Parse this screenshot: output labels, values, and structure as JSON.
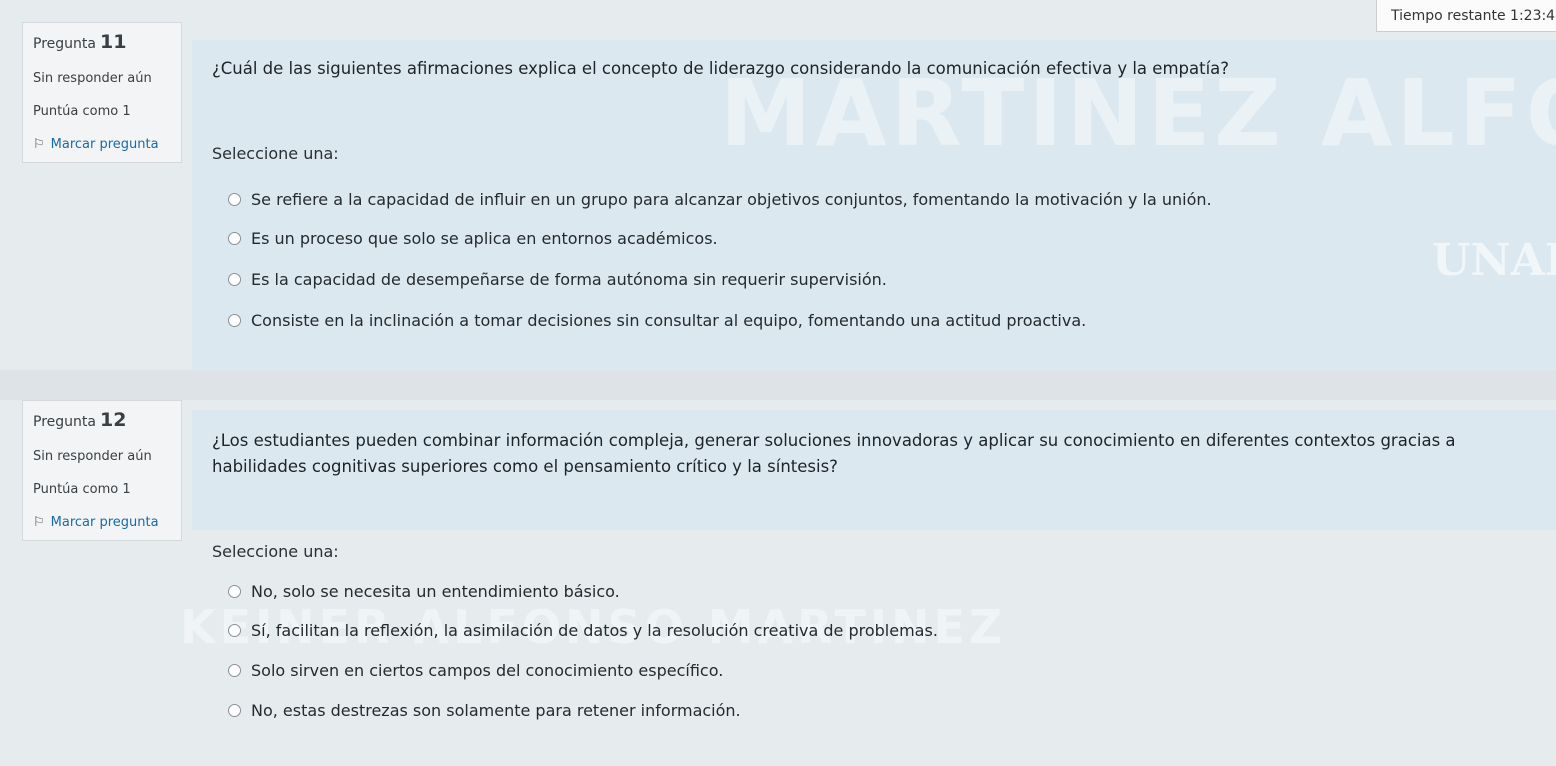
{
  "timer": {
    "label": "Tiempo restante",
    "value": "1:23:4"
  },
  "questions": [
    {
      "label": "Pregunta",
      "number": "11",
      "status": "Sin responder aún",
      "points": "Puntúa como 1",
      "flag_label": "Marcar pregunta",
      "text": "¿Cuál de las siguientes afirmaciones explica el concepto de liderazgo considerando la comunicación efectiva y la empatía?",
      "prompt": "Seleccione una:",
      "options": [
        "Se refiere a la capacidad de influir en un grupo para alcanzar objetivos conjuntos, fomentando la motivación y la unión.",
        "Es un proceso que solo se aplica en entornos académicos.",
        "Es la capacidad de desempeñarse de forma autónoma sin requerir supervisión.",
        "Consiste en la inclinación a tomar decisiones sin consultar al equipo, fomentando una actitud proactiva."
      ]
    },
    {
      "label": "Pregunta",
      "number": "12",
      "status": "Sin responder aún",
      "points": "Puntúa como 1",
      "flag_label": "Marcar pregunta",
      "text": "¿Los estudiantes pueden combinar información compleja, generar soluciones innovadoras y aplicar su conocimiento en diferentes contextos gracias a habilidades cognitivas superiores como el pensamiento crítico y la síntesis?",
      "prompt": "Seleccione una:",
      "options": [
        "No, solo se necesita un entendimiento básico.",
        "Sí, facilitan la reflexión, la asimilación de datos y la resolución creativa de problemas.",
        "Solo sirven en ciertos campos del conocimiento específico.",
        "No, estas destrezas son solamente para retener información."
      ]
    }
  ],
  "watermark": {
    "line1": "MARTINEZ ALFONSO",
    "line2": "KEINER ALFONSO MARTINEZ",
    "logo": "UNAD"
  },
  "colors": {
    "question_bg": "#dbe8ef",
    "info_bg": "#f2f4f5",
    "flag_link": "#1a6aa6"
  }
}
